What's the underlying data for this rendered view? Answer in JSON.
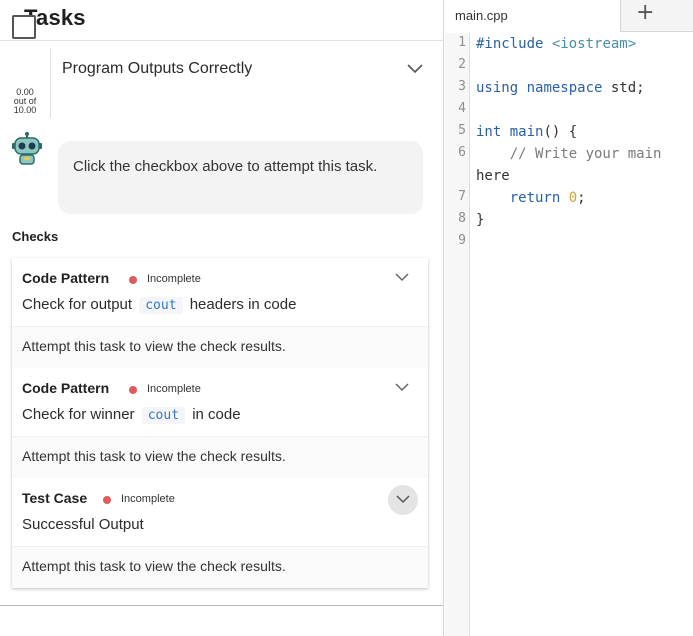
{
  "tasks_panel": {
    "title": "Tasks",
    "task": {
      "title": "Program Outputs Correctly",
      "score": "0.00",
      "score_out_of": "out of",
      "score_max": "10.00"
    },
    "assistant_message": "Click the checkbox above to attempt this task.",
    "checks_heading": "Checks",
    "checks": [
      {
        "type": "Code Pattern",
        "status": "Incomplete",
        "desc_before": "Check for output",
        "code": "cout",
        "desc_after": "headers in code",
        "result": "Attempt this task to view the check results."
      },
      {
        "type": "Code Pattern",
        "status": "Incomplete",
        "desc_before": "Check for winner",
        "code": "cout",
        "desc_after": "in code",
        "result": "Attempt this task to view the check results."
      },
      {
        "type": "Test Case",
        "status": "Incomplete",
        "desc_before": "Successful Output",
        "code": "",
        "desc_after": "",
        "result": "Attempt this task to view the check results."
      }
    ],
    "colors": {
      "status_incomplete": "#e05b5b",
      "code_text": "#3477c7"
    }
  },
  "editor": {
    "tab_label": "main.cpp",
    "add_tab_icon": "plus-icon",
    "line_numbers": [
      "1",
      "2",
      "3",
      "4",
      "5",
      "6",
      "7",
      "8",
      "9"
    ],
    "code_lines": [
      "#include <iostream>",
      "",
      "using namespace std;",
      "",
      "int main() {",
      "    // Write your main",
      "here",
      "    return 0;",
      "}",
      ""
    ]
  }
}
